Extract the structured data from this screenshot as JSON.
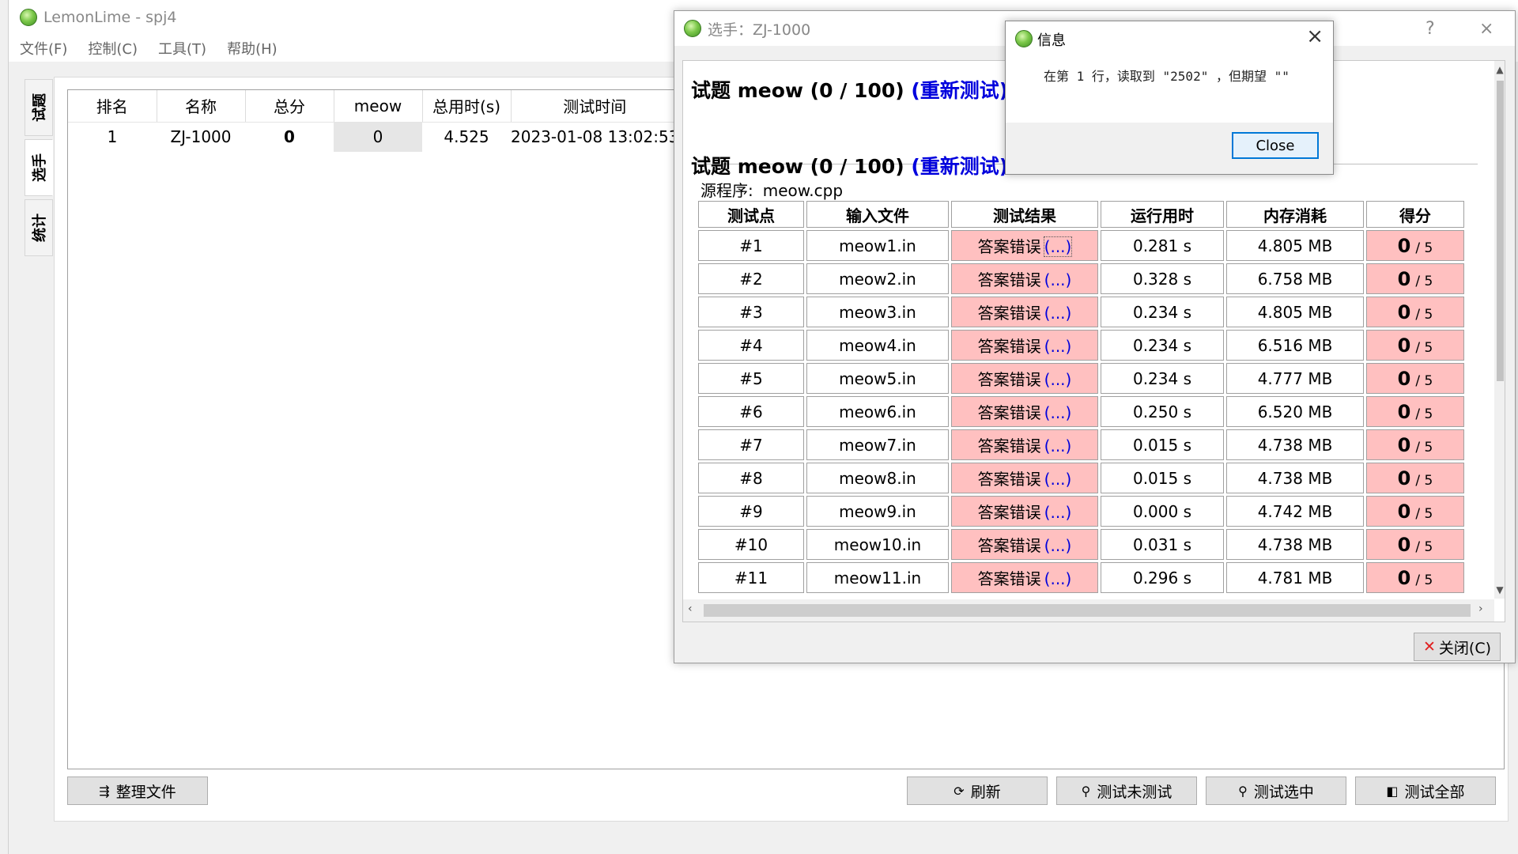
{
  "main": {
    "title": "LemonLime - spj4",
    "menu": [
      "文件(F)",
      "控制(C)",
      "工具(T)",
      "帮助(H)"
    ],
    "side_tabs": [
      "试题",
      "选手",
      "统计"
    ],
    "standings": {
      "headers": [
        "排名",
        "名称",
        "总分",
        "meow",
        "总用时(s)",
        "测试时间"
      ],
      "row": [
        "1",
        "ZJ-1000",
        "0",
        "0",
        "4.525",
        "2023-01-08 13:02:53"
      ]
    },
    "buttons": {
      "organize": "整理文件",
      "refresh": "刷新",
      "test_untested": "测试未测试",
      "test_selected": "测试选中",
      "test_all": "测试全部"
    }
  },
  "dialog": {
    "title": "选手：ZJ-1000",
    "help": "?",
    "close_x": "×",
    "task_label": "试题 meow (0 / 100)",
    "retest_label": "(重新测试)",
    "source_label": "源程序:",
    "source_file": "meow.cpp",
    "table_headers": [
      "测试点",
      "输入文件",
      "测试结果",
      "运行用时",
      "内存消耗",
      "得分"
    ],
    "result_text": "答案错误",
    "dots": "(...)",
    "score_zero": "0",
    "score_max": "/ 5",
    "rows": [
      {
        "id": "#1",
        "file": "meow1.in",
        "time": "0.281 s",
        "mem": "4.805 MB"
      },
      {
        "id": "#2",
        "file": "meow2.in",
        "time": "0.328 s",
        "mem": "6.758 MB"
      },
      {
        "id": "#3",
        "file": "meow3.in",
        "time": "0.234 s",
        "mem": "4.805 MB"
      },
      {
        "id": "#4",
        "file": "meow4.in",
        "time": "0.234 s",
        "mem": "6.516 MB"
      },
      {
        "id": "#5",
        "file": "meow5.in",
        "time": "0.234 s",
        "mem": "4.777 MB"
      },
      {
        "id": "#6",
        "file": "meow6.in",
        "time": "0.250 s",
        "mem": "6.520 MB"
      },
      {
        "id": "#7",
        "file": "meow7.in",
        "time": "0.015 s",
        "mem": "4.738 MB"
      },
      {
        "id": "#8",
        "file": "meow8.in",
        "time": "0.015 s",
        "mem": "4.738 MB"
      },
      {
        "id": "#9",
        "file": "meow9.in",
        "time": "0.000 s",
        "mem": "4.742 MB"
      },
      {
        "id": "#10",
        "file": "meow10.in",
        "time": "0.031 s",
        "mem": "4.738 MB"
      },
      {
        "id": "#11",
        "file": "meow11.in",
        "time": "0.296 s",
        "mem": "4.781 MB"
      }
    ],
    "close_button": "关闭(C)"
  },
  "info": {
    "title": "信息",
    "message": "在第 1 行，读取到 \"2502\" ，但期望 \"\"",
    "close_button": "Close"
  },
  "colors": {
    "wrong_answer_bg": "#ffc0c0",
    "link_blue": "#0000dd",
    "button_focus_border": "#0078d7"
  }
}
